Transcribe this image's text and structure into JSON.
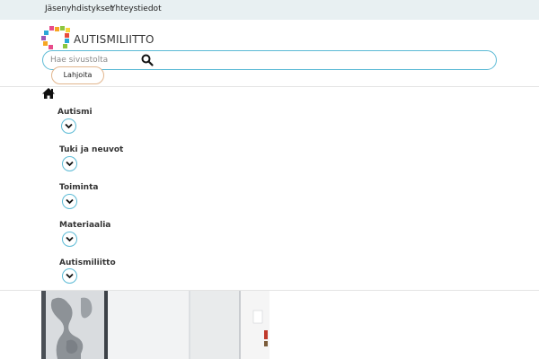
{
  "topbar": {
    "links": [
      "Jäsenyhdistykset",
      "Yhteystiedot"
    ]
  },
  "logo": {
    "text": "AUTISMILIITTO",
    "icon": "colorful-squares-logo-mark"
  },
  "search": {
    "placeholder": "Hae sivustolta",
    "icon": "search-icon"
  },
  "donate": {
    "label": "Lahjoita"
  },
  "nav": {
    "home_icon": "home-icon",
    "items": [
      {
        "label": "Autismi"
      },
      {
        "label": "Tuki ja neuvot"
      },
      {
        "label": "Toiminta"
      },
      {
        "label": "Materiaalia"
      },
      {
        "label": "Autismiliitto"
      }
    ]
  },
  "colors": {
    "accent": "#5bbad5",
    "donate_border": "#e2b68e",
    "topbar_bg": "#e8f0f2"
  }
}
